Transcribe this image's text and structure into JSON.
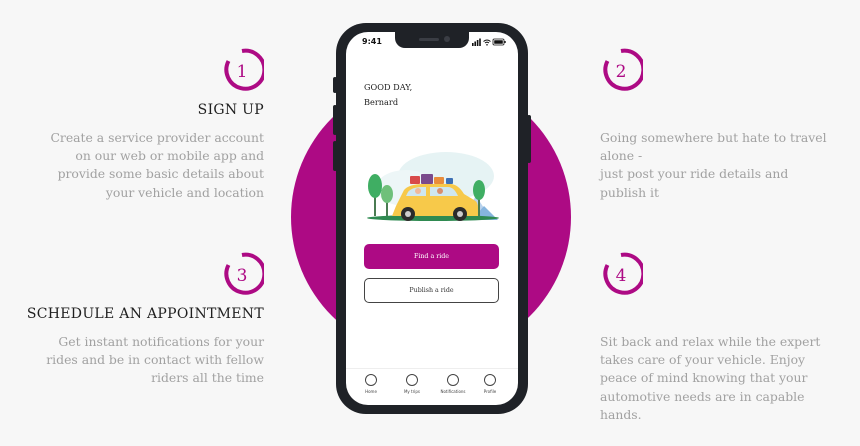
{
  "colors": {
    "accent": "#ad0a84",
    "text_dark": "#1f1f1f",
    "text_muted": "#a1a1a1"
  },
  "steps": [
    {
      "number": "1",
      "title": "SIGN UP",
      "text": "Create a service provider account\non our web or mobile app and\nprovide some basic details about\nyour vehicle and location"
    },
    {
      "number": "2",
      "title": "",
      "text": "Going somewhere but hate to travel\nalone -\njust post your ride details and\npublish it"
    },
    {
      "number": "3",
      "title": "SCHEDULE AN APPOINTMENT",
      "text": "Get instant notifications for your\nrides and be in contact with fellow\nriders all the time"
    },
    {
      "number": "4",
      "title": "",
      "text": "Sit back and relax while the expert\ntakes care of your vehicle. Enjoy\npeace of mind knowing that your\nautomotive needs are in capable\nhands."
    }
  ],
  "phone": {
    "time": "9:41",
    "greeting": "GOOD DAY,",
    "username": "Bernard",
    "illustration": "car-trip-illustration",
    "find_button": "Find a ride",
    "publish_button": "Publish a ride",
    "nav": [
      {
        "label": "Home",
        "icon": "home-icon"
      },
      {
        "label": "My trips",
        "icon": "trips-icon"
      },
      {
        "label": "Notifications",
        "icon": "bell-icon"
      },
      {
        "label": "Profile",
        "icon": "profile-icon"
      }
    ]
  }
}
